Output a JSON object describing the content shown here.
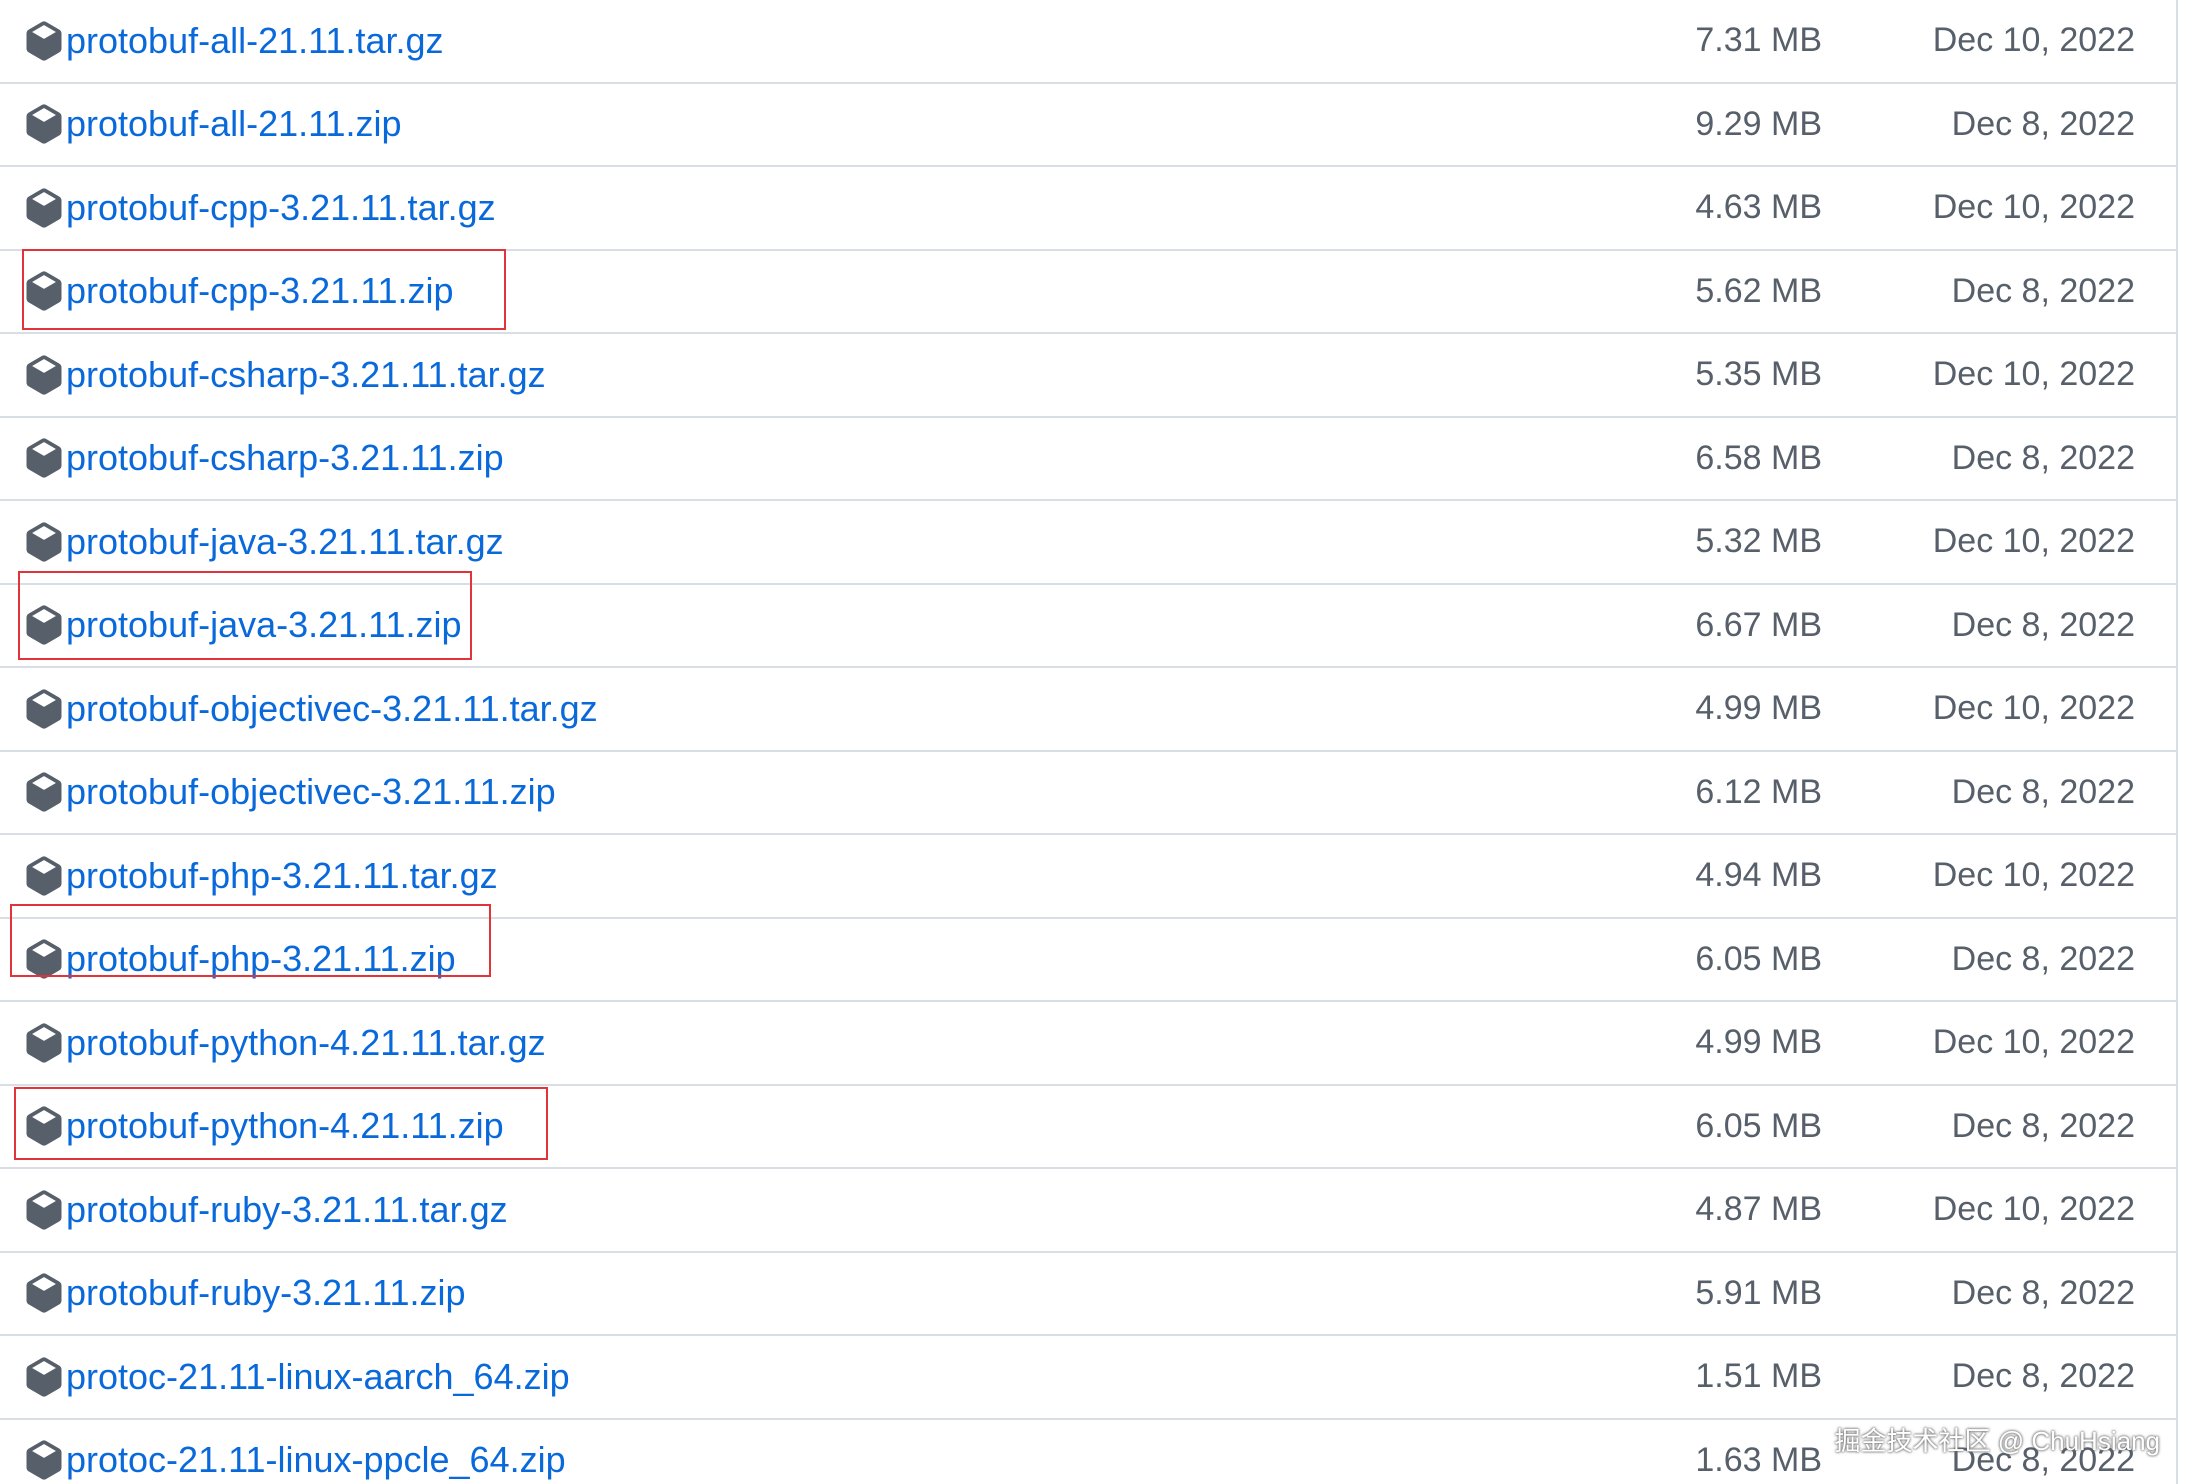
{
  "assets": [
    {
      "name": "protobuf-all-21.11.tar.gz",
      "size": "7.31 MB",
      "date": "Dec 10, 2022"
    },
    {
      "name": "protobuf-all-21.11.zip",
      "size": "9.29 MB",
      "date": "Dec 8, 2022"
    },
    {
      "name": "protobuf-cpp-3.21.11.tar.gz",
      "size": "4.63 MB",
      "date": "Dec 10, 2022"
    },
    {
      "name": "protobuf-cpp-3.21.11.zip",
      "size": "5.62 MB",
      "date": "Dec 8, 2022"
    },
    {
      "name": "protobuf-csharp-3.21.11.tar.gz",
      "size": "5.35 MB",
      "date": "Dec 10, 2022"
    },
    {
      "name": "protobuf-csharp-3.21.11.zip",
      "size": "6.58 MB",
      "date": "Dec 8, 2022"
    },
    {
      "name": "protobuf-java-3.21.11.tar.gz",
      "size": "5.32 MB",
      "date": "Dec 10, 2022"
    },
    {
      "name": "protobuf-java-3.21.11.zip",
      "size": "6.67 MB",
      "date": "Dec 8, 2022"
    },
    {
      "name": "protobuf-objectivec-3.21.11.tar.gz",
      "size": "4.99 MB",
      "date": "Dec 10, 2022"
    },
    {
      "name": "protobuf-objectivec-3.21.11.zip",
      "size": "6.12 MB",
      "date": "Dec 8, 2022"
    },
    {
      "name": "protobuf-php-3.21.11.tar.gz",
      "size": "4.94 MB",
      "date": "Dec 10, 2022"
    },
    {
      "name": "protobuf-php-3.21.11.zip",
      "size": "6.05 MB",
      "date": "Dec 8, 2022"
    },
    {
      "name": "protobuf-python-4.21.11.tar.gz",
      "size": "4.99 MB",
      "date": "Dec 10, 2022"
    },
    {
      "name": "protobuf-python-4.21.11.zip",
      "size": "6.05 MB",
      "date": "Dec 8, 2022"
    },
    {
      "name": "protobuf-ruby-3.21.11.tar.gz",
      "size": "4.87 MB",
      "date": "Dec 10, 2022"
    },
    {
      "name": "protobuf-ruby-3.21.11.zip",
      "size": "5.91 MB",
      "date": "Dec 8, 2022"
    },
    {
      "name": "protoc-21.11-linux-aarch_64.zip",
      "size": "1.51 MB",
      "date": "Dec 8, 2022"
    },
    {
      "name": "protoc-21.11-linux-ppcle_64.zip",
      "size": "1.63 MB",
      "date": "Dec 8, 2022"
    }
  ],
  "icon": "package-icon",
  "colors": {
    "link": "#0969da",
    "muted": "#57606a",
    "border": "#d8dee4",
    "highlight": "#e0343a"
  },
  "watermark": "掘金技术社区 @ ChuHsiang"
}
